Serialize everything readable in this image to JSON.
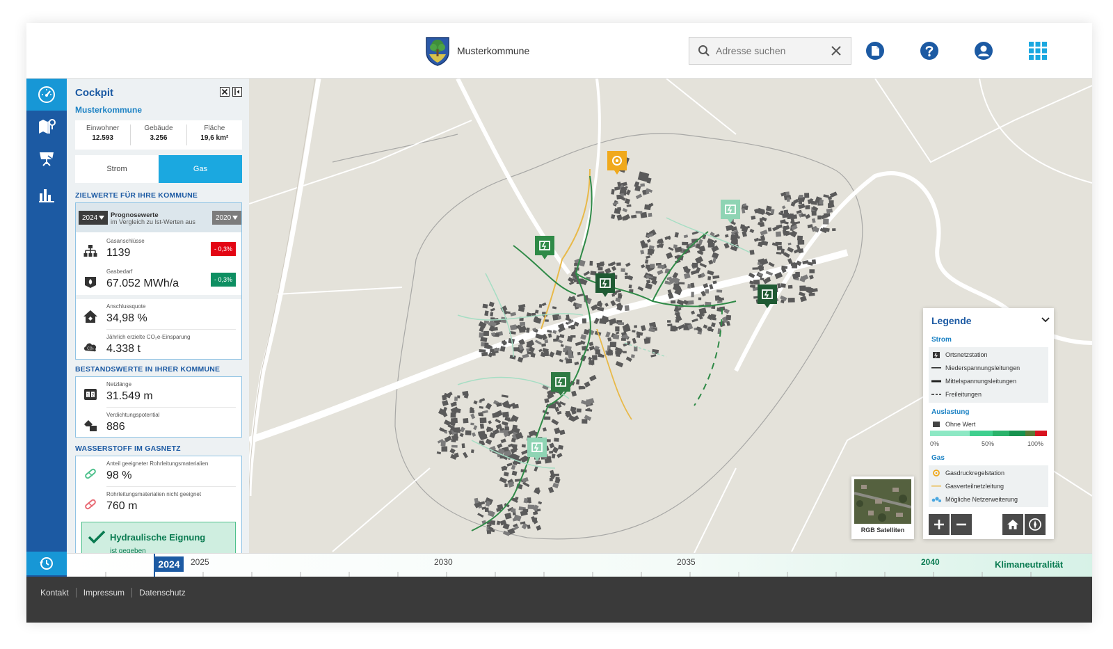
{
  "header": {
    "municipality": "Musterkommune",
    "search_placeholder": "Adresse suchen"
  },
  "panel": {
    "title": "Cockpit",
    "subtitle": "Musterkommune",
    "stats": [
      {
        "label": "Einwohner",
        "value": "12.593"
      },
      {
        "label": "Gebäude",
        "value": "3.256"
      },
      {
        "label": "Fläche",
        "value": "19,6 km²"
      }
    ],
    "toggle": {
      "left": "Strom",
      "right": "Gas",
      "active": "Gas"
    },
    "targets": {
      "heading": "ZIELWERTE FÜR IHRE KOMMUNE",
      "year_left": "2024",
      "year_right": "2020",
      "prog_title": "Prognosewerte",
      "prog_sub": "im Vergleich zu Ist-Werten aus",
      "rows": [
        {
          "label": "Gasanschlüsse",
          "value": "1139",
          "badge": "- 0,3%",
          "badge_color": "red"
        },
        {
          "label": "Gasbedarf",
          "value": "67.052 MWh/a",
          "badge": "- 0,3%",
          "badge_color": "green"
        },
        {
          "label": "Anschlussquote",
          "value": "34,98 %"
        },
        {
          "label": "Jährlich erzielte CO₂e-Einsparung",
          "value": "4.338 t"
        }
      ]
    },
    "inventory": {
      "heading": "BESTANDSWERTE IN IHRER KOMMUNE",
      "rows": [
        {
          "label": "Netzlänge",
          "value": "31.549 m"
        },
        {
          "label": "Verdichtungspotential",
          "value": "886"
        }
      ]
    },
    "hydrogen": {
      "heading": "WASSERSTOFF IM GASNETZ",
      "rows": [
        {
          "label": "Anteil geeigneter Rohrleitungsmaterialien",
          "value": "98 %"
        },
        {
          "label": "Rohrleitungsmaterialien nicht geeignet",
          "value": "760 m"
        }
      ],
      "suitability_title": "Hydraulische Eignung",
      "suitability_sub": "ist gegeben"
    }
  },
  "legend": {
    "title": "Legende",
    "strom_heading": "Strom",
    "strom_items": [
      "Ortsnetzstation",
      "Niederspannungsleitungen",
      "Mittelspannungsleitungen",
      "Freileitungen"
    ],
    "load_heading": "Auslastung",
    "load_none": "Ohne Wert",
    "load_ticks": [
      "0%",
      "50%",
      "100%"
    ],
    "gas_heading": "Gas",
    "gas_items": [
      "Gasdruckregelstation",
      "Gasverteilnetzleitung",
      "Mögliche Netzerweiterung"
    ]
  },
  "satellite": {
    "label": "RGB Satelliten"
  },
  "timeline": {
    "current": "2024",
    "ticks": [
      "2025",
      "2030",
      "2035",
      "2040"
    ],
    "goal": "Klimaneutralität"
  },
  "footer": {
    "links": [
      "Kontakt",
      "Impressum",
      "Datenschutz"
    ]
  },
  "colors": {
    "primary": "#1c5aa3",
    "accent": "#1ba8e0",
    "gas_line": "#e8b949",
    "station_dark": "#2a6b3e",
    "station_light": "#8fd4b4",
    "danger": "#e30614",
    "success": "#0e8f62"
  }
}
